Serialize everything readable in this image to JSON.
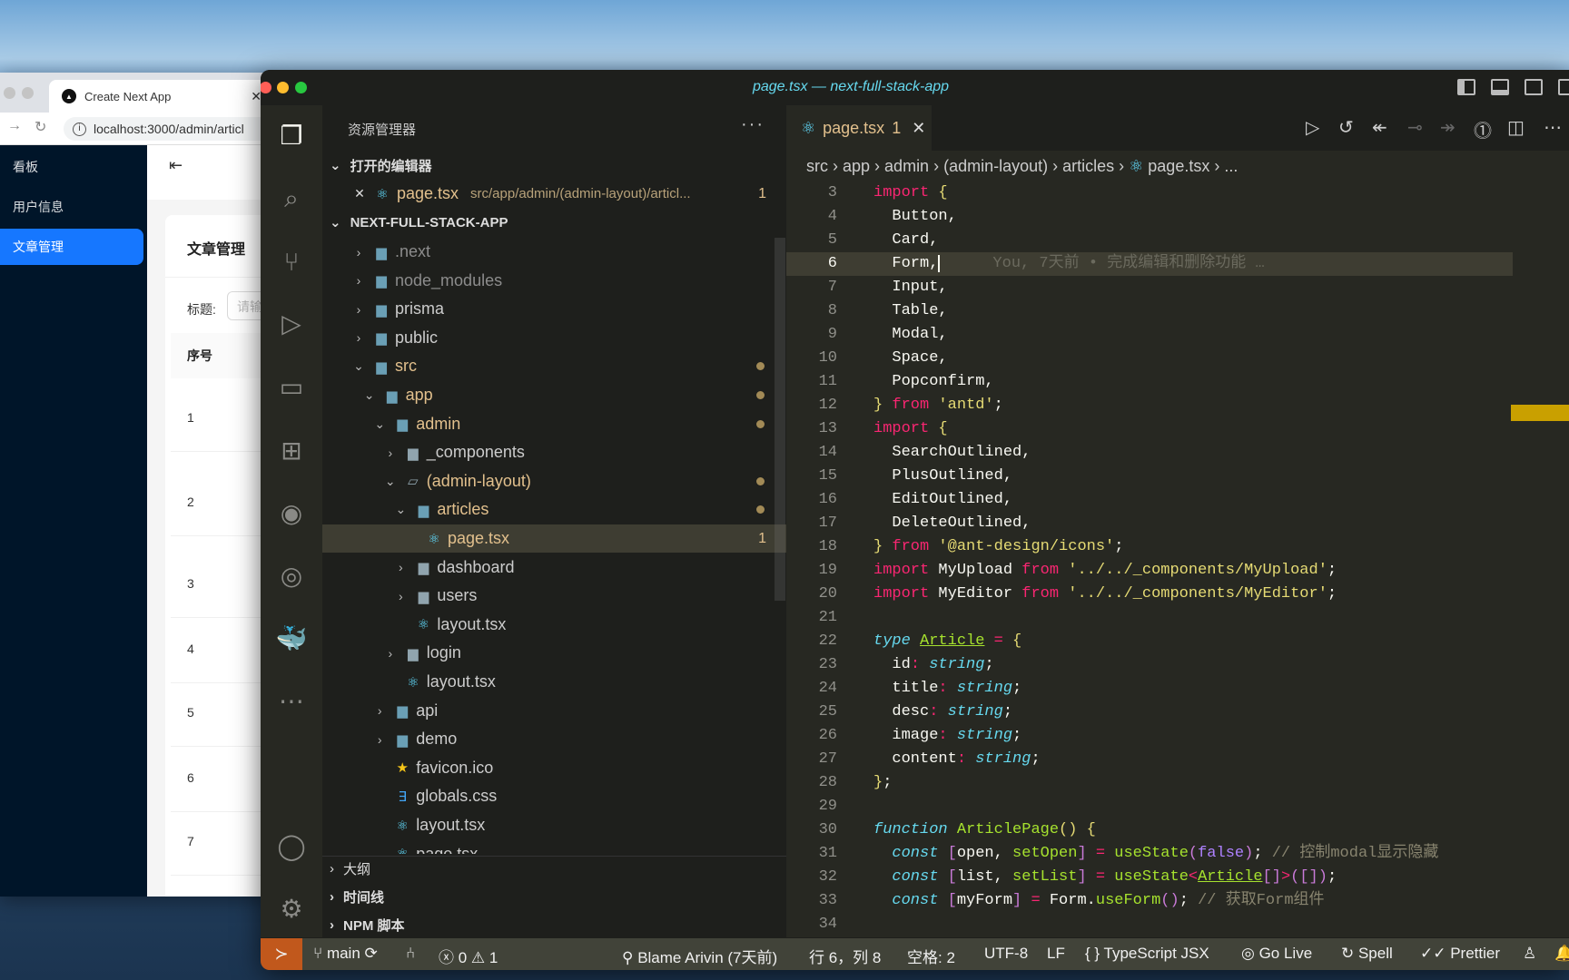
{
  "browser": {
    "tab_title": "Create Next App",
    "url": "localhost:3000/admin/articl",
    "menu": [
      {
        "label": "看板",
        "icon": "dashboard-icon"
      },
      {
        "label": "用户信息",
        "icon": "user-icon"
      },
      {
        "label": "文章管理",
        "icon": "article-icon",
        "selected": true
      }
    ],
    "card_title": "文章管理",
    "search_label": "标题:",
    "search_placeholder": "请输",
    "table_header": "序号",
    "rows": [
      "1",
      "2",
      "3",
      "4",
      "5",
      "6",
      "7"
    ],
    "primary_color": "#1677ff",
    "sidebar_color": "#001529"
  },
  "vscode": {
    "window_title": "page.tsx — next-full-stack-app",
    "explorer_title": "资源管理器",
    "open_editors": "打开的编辑器",
    "open_file": {
      "name": "page.tsx",
      "path": "src/app/admin/(admin-layout)/articl...",
      "problems": "1"
    },
    "project": "NEXT-FULL-STACK-APP",
    "tree": [
      {
        "name": ".next",
        "level": 0,
        "type": "folder",
        "open": false,
        "icon": "next-folder-icon",
        "color": "#8c8c8c"
      },
      {
        "name": "node_modules",
        "level": 0,
        "type": "folder",
        "open": false,
        "icon": "node-folder-icon",
        "color": "#8c8c8c"
      },
      {
        "name": "prisma",
        "level": 0,
        "type": "folder",
        "open": false,
        "icon": "prisma-folder-icon"
      },
      {
        "name": "public",
        "level": 0,
        "type": "folder",
        "open": false,
        "icon": "public-folder-icon"
      },
      {
        "name": "src",
        "level": 0,
        "type": "folder",
        "open": true,
        "icon": "src-folder-icon",
        "modified": true
      },
      {
        "name": "app",
        "level": 1,
        "type": "folder",
        "open": true,
        "icon": "app-folder-icon",
        "modified": true
      },
      {
        "name": "admin",
        "level": 2,
        "type": "folder",
        "open": true,
        "icon": "admin-folder-icon",
        "modified": true
      },
      {
        "name": "_components",
        "level": 3,
        "type": "folder",
        "open": false,
        "icon": "folder-icon"
      },
      {
        "name": "(admin-layout)",
        "level": 3,
        "type": "folder",
        "open": true,
        "icon": "folder-open-icon",
        "modified": true
      },
      {
        "name": "articles",
        "level": 4,
        "type": "folder",
        "open": true,
        "icon": "articles-folder-icon",
        "modified": true
      },
      {
        "name": "page.tsx",
        "level": 5,
        "type": "file",
        "icon": "react-icon",
        "modified": true,
        "selected": true,
        "problems": "1"
      },
      {
        "name": "dashboard",
        "level": 4,
        "type": "folder",
        "open": false,
        "icon": "folder-icon"
      },
      {
        "name": "users",
        "level": 4,
        "type": "folder",
        "open": false,
        "icon": "folder-icon"
      },
      {
        "name": "layout.tsx",
        "level": 4,
        "type": "file",
        "icon": "react-icon"
      },
      {
        "name": "login",
        "level": 3,
        "type": "folder",
        "open": false,
        "icon": "folder-icon"
      },
      {
        "name": "layout.tsx",
        "level": 3,
        "type": "file",
        "icon": "react-icon"
      },
      {
        "name": "api",
        "level": 2,
        "type": "folder",
        "open": false,
        "icon": "api-folder-icon"
      },
      {
        "name": "demo",
        "level": 2,
        "type": "folder",
        "open": false,
        "icon": "demo-folder-icon"
      },
      {
        "name": "favicon.ico",
        "level": 2,
        "type": "file",
        "icon": "star-icon"
      },
      {
        "name": "globals.css",
        "level": 2,
        "type": "file",
        "icon": "css-icon"
      },
      {
        "name": "layout.tsx",
        "level": 2,
        "type": "file",
        "icon": "react-icon"
      },
      {
        "name": "page.tsx",
        "level": 2,
        "type": "file",
        "icon": "react-icon"
      }
    ],
    "bottom_sections": [
      "大纲",
      "时间线",
      "NPM 脚本"
    ],
    "tab": {
      "name": "page.tsx",
      "problems": "1"
    },
    "breadcrumb": [
      "src",
      "app",
      "admin",
      "(admin-layout)",
      "articles",
      "page.tsx",
      "..."
    ],
    "cursor_line": 6,
    "blame_ghost": "You, 7天前 • 完成编辑和删除功能 …",
    "code": [
      {
        "n": "3",
        "t": [
          [
            "k",
            "import"
          ],
          [
            "p",
            " "
          ],
          [
            "b",
            "{"
          ]
        ]
      },
      {
        "n": "4",
        "t": [
          [
            "p",
            "  Button,"
          ]
        ]
      },
      {
        "n": "5",
        "t": [
          [
            "p",
            "  Card,"
          ]
        ]
      },
      {
        "n": "6",
        "t": [
          [
            "p",
            "  Form,"
          ]
        ]
      },
      {
        "n": "7",
        "t": [
          [
            "p",
            "  Input,"
          ]
        ]
      },
      {
        "n": "8",
        "t": [
          [
            "p",
            "  Table,"
          ]
        ]
      },
      {
        "n": "9",
        "t": [
          [
            "p",
            "  Modal,"
          ]
        ]
      },
      {
        "n": "10",
        "t": [
          [
            "p",
            "  Space,"
          ]
        ]
      },
      {
        "n": "11",
        "t": [
          [
            "p",
            "  Popconfirm,"
          ]
        ]
      },
      {
        "n": "12",
        "t": [
          [
            "b",
            "}"
          ],
          [
            "p",
            " "
          ],
          [
            "k",
            "from"
          ],
          [
            "p",
            " "
          ],
          [
            "s",
            "'antd'"
          ],
          [
            "p",
            ";"
          ]
        ]
      },
      {
        "n": "13",
        "t": [
          [
            "k",
            "import"
          ],
          [
            "p",
            " "
          ],
          [
            "b",
            "{"
          ]
        ]
      },
      {
        "n": "14",
        "t": [
          [
            "p",
            "  SearchOutlined,"
          ]
        ]
      },
      {
        "n": "15",
        "t": [
          [
            "p",
            "  PlusOutlined,"
          ]
        ]
      },
      {
        "n": "16",
        "t": [
          [
            "p",
            "  EditOutlined,"
          ]
        ]
      },
      {
        "n": "17",
        "t": [
          [
            "p",
            "  DeleteOutlined,"
          ]
        ]
      },
      {
        "n": "18",
        "t": [
          [
            "b",
            "}"
          ],
          [
            "p",
            " "
          ],
          [
            "k",
            "from"
          ],
          [
            "p",
            " "
          ],
          [
            "s",
            "'@ant-design/icons'"
          ],
          [
            "p",
            ";"
          ]
        ]
      },
      {
        "n": "19",
        "t": [
          [
            "k",
            "import"
          ],
          [
            "p",
            " MyUpload "
          ],
          [
            "k",
            "from"
          ],
          [
            "p",
            " "
          ],
          [
            "s",
            "'../../_components/MyUpload'"
          ],
          [
            "p",
            ";"
          ]
        ]
      },
      {
        "n": "20",
        "t": [
          [
            "k",
            "import"
          ],
          [
            "p",
            " MyEditor "
          ],
          [
            "k",
            "from"
          ],
          [
            "p",
            " "
          ],
          [
            "s",
            "'../../_components/MyEditor'"
          ],
          [
            "p",
            ";"
          ]
        ]
      },
      {
        "n": "21",
        "t": []
      },
      {
        "n": "22",
        "t": [
          [
            "t",
            "type"
          ],
          [
            "p",
            " "
          ],
          [
            "u",
            "Article"
          ],
          [
            "p",
            " "
          ],
          [
            "k",
            "="
          ],
          [
            "p",
            " "
          ],
          [
            "b",
            "{"
          ]
        ]
      },
      {
        "n": "23",
        "t": [
          [
            "p",
            "  id"
          ],
          [
            "k",
            ":"
          ],
          [
            "p",
            " "
          ],
          [
            "t",
            "string"
          ],
          [
            "p",
            ";"
          ]
        ]
      },
      {
        "n": "24",
        "t": [
          [
            "p",
            "  title"
          ],
          [
            "k",
            ":"
          ],
          [
            "p",
            " "
          ],
          [
            "t",
            "string"
          ],
          [
            "p",
            ";"
          ]
        ]
      },
      {
        "n": "25",
        "t": [
          [
            "p",
            "  desc"
          ],
          [
            "k",
            ":"
          ],
          [
            "p",
            " "
          ],
          [
            "t",
            "string"
          ],
          [
            "p",
            ";"
          ]
        ]
      },
      {
        "n": "26",
        "t": [
          [
            "p",
            "  image"
          ],
          [
            "k",
            ":"
          ],
          [
            "p",
            " "
          ],
          [
            "t",
            "string"
          ],
          [
            "p",
            ";"
          ]
        ]
      },
      {
        "n": "27",
        "t": [
          [
            "p",
            "  content"
          ],
          [
            "k",
            ":"
          ],
          [
            "p",
            " "
          ],
          [
            "t",
            "string"
          ],
          [
            "p",
            ";"
          ]
        ]
      },
      {
        "n": "28",
        "t": [
          [
            "b",
            "}"
          ],
          [
            "p",
            ";"
          ]
        ]
      },
      {
        "n": "29",
        "t": []
      },
      {
        "n": "30",
        "t": [
          [
            "t",
            "function"
          ],
          [
            "p",
            " "
          ],
          [
            "f",
            "ArticlePage"
          ],
          [
            "b",
            "()"
          ],
          [
            "p",
            " "
          ],
          [
            "b",
            "{"
          ]
        ]
      },
      {
        "n": "31",
        "t": [
          [
            "p",
            "  "
          ],
          [
            "t",
            "const"
          ],
          [
            "p",
            " "
          ],
          [
            "bp",
            "["
          ],
          [
            "p",
            "open, "
          ],
          [
            "f",
            "setOpen"
          ],
          [
            "bp",
            "]"
          ],
          [
            "p",
            " "
          ],
          [
            "k",
            "="
          ],
          [
            "p",
            " "
          ],
          [
            "f",
            "useState"
          ],
          [
            "bp",
            "("
          ],
          [
            "n",
            "false"
          ],
          [
            "bp",
            ")"
          ],
          [
            "p",
            "; "
          ],
          [
            "c",
            "// 控制modal显示隐藏"
          ]
        ]
      },
      {
        "n": "32",
        "t": [
          [
            "p",
            "  "
          ],
          [
            "t",
            "const"
          ],
          [
            "p",
            " "
          ],
          [
            "bp",
            "["
          ],
          [
            "p",
            "list, "
          ],
          [
            "f",
            "setList"
          ],
          [
            "bp",
            "]"
          ],
          [
            "p",
            " "
          ],
          [
            "k",
            "="
          ],
          [
            "p",
            " "
          ],
          [
            "f",
            "useState"
          ],
          [
            "k",
            "<"
          ],
          [
            "u",
            "Article"
          ],
          [
            "bp",
            "[]"
          ],
          [
            "k",
            ">"
          ],
          [
            "bp",
            "("
          ],
          [
            "bp",
            "[]"
          ],
          [
            "bp",
            ")"
          ],
          [
            "p",
            ";"
          ]
        ]
      },
      {
        "n": "33",
        "t": [
          [
            "p",
            "  "
          ],
          [
            "t",
            "const"
          ],
          [
            "p",
            " "
          ],
          [
            "bp",
            "["
          ],
          [
            "p",
            "myForm"
          ],
          [
            "bp",
            "]"
          ],
          [
            "p",
            " "
          ],
          [
            "k",
            "="
          ],
          [
            "p",
            " Form."
          ],
          [
            "f",
            "useForm"
          ],
          [
            "bp",
            "()"
          ],
          [
            "p",
            "; "
          ],
          [
            "c",
            "// 获取Form组件"
          ]
        ]
      },
      {
        "n": "34",
        "t": []
      }
    ],
    "status": {
      "branch": "main",
      "errors": "0",
      "warnings": "1",
      "blame": "Blame Arivin (7天前)",
      "position": "行 6，列 8",
      "spaces": "空格: 2",
      "encoding": "UTF-8",
      "eol": "LF",
      "language": "TypeScript JSX",
      "golive": "Go Live",
      "spell": "Spell",
      "prettier": "Prettier"
    },
    "colors": {
      "keyword": "#f92672",
      "string": "#e6db74",
      "type": "#66d9ef",
      "function": "#a6e22e",
      "remote": "#c1581c",
      "modified": "#e2c08d"
    }
  }
}
